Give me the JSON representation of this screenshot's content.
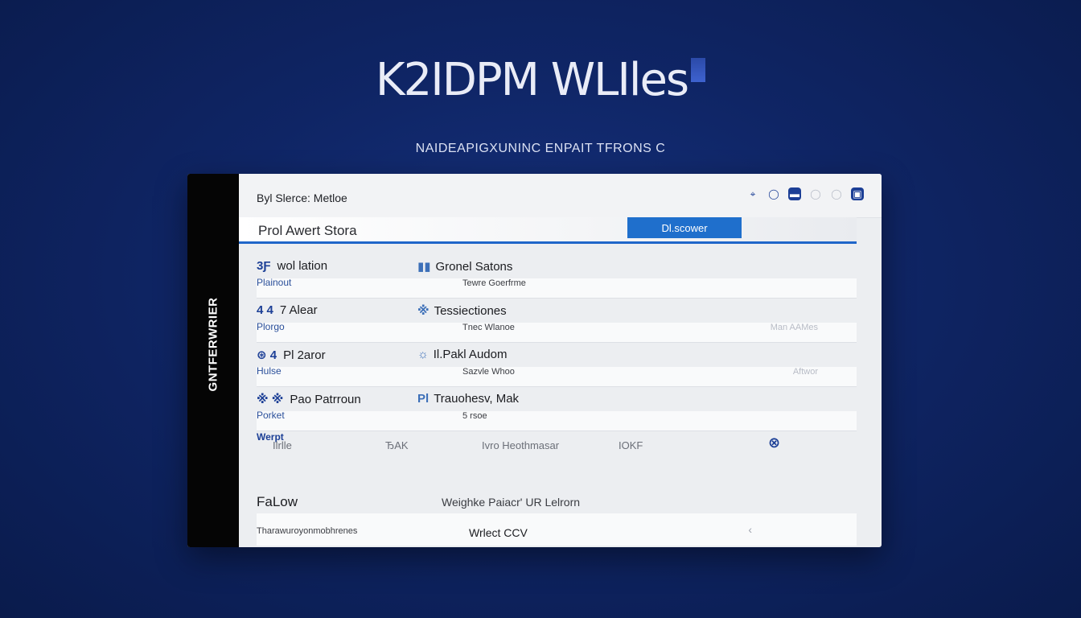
{
  "hero": {
    "title": "K2IDPM WLIles",
    "subtitle": "NAIDEAPIGXUNINC ENPAIT TFRONS C"
  },
  "window": {
    "side_label": "GNTFERWRIER",
    "title": "Byl Slerce: Metloe",
    "search": {
      "value": "",
      "placeholder": "Prol Awert Stora"
    },
    "discover_label": "Dl.scower",
    "toolbar_icons": [
      "location-icon",
      "pin-icon",
      "chat-icon",
      "info-icon",
      "settings-icon",
      "export-icon"
    ]
  },
  "rows": [
    {
      "badge": "3Ƒ",
      "name": "wol lation",
      "sub": "Plainout",
      "mid_badge": "▮▮",
      "mid": "Gronel Satons",
      "midsub": "Tewre Goerfrme",
      "right": ""
    },
    {
      "badge": "4 4",
      "name": "7  Alear",
      "sub": "Plorgo",
      "mid_badge": "※",
      "mid": "Tessiectiones",
      "midsub": "Tnec Wlanoe",
      "right": "Man AAMes"
    },
    {
      "badge": "⊛ 4",
      "name": "Pl 2aror",
      "sub": "Hulse",
      "mid_badge": "☼",
      "mid": "Il.Pakl Audom",
      "midsub": "Sazvle Whoo",
      "right": "Aftwor"
    },
    {
      "badge": "※ ※",
      "name": "Pao Patrroun",
      "sub": "Porket",
      "mid_badge": "Pl",
      "mid": "Trauohesv, Mak",
      "midsub": "5 rsoe",
      "right": ""
    }
  ],
  "bottom": {
    "label_a": "Werpt",
    "icon_row": [
      "Ilrlle",
      "ЂAK",
      "Ivro Heothmasar",
      "IOKF"
    ],
    "title": "FaLow",
    "link": "Weighke Paiacr' UR Lelrorn",
    "desc": "Tharawuroyonmobhrenes",
    "cta": "Wrlect CCV"
  }
}
